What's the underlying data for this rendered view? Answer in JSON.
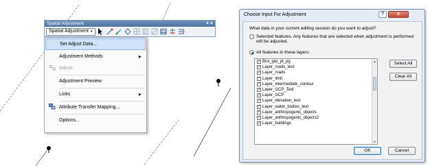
{
  "toolbar": {
    "title": "Spatial Adjustment",
    "close_glyph": "× ×",
    "dropdown_label": "Spatial Adjustment",
    "dropdown_caret": "▾",
    "tools": [
      "select-pointer-icon",
      "new-displacement-link-icon",
      "modify-link-icon",
      "multi-displacement-link-icon",
      "identity-link-icon",
      "area-of-effect-icon",
      "multi-link-icon",
      "view-link-table-icon",
      "edge-match-icon",
      "attribute-transfer-icon"
    ]
  },
  "menu": {
    "items": [
      {
        "label": "Set Adjust Data...",
        "state": "selected"
      },
      {
        "label": "Adjustment Methods",
        "submenu": true
      },
      {
        "label": "Adjust",
        "state": "disabled"
      },
      {
        "label": "Adjustment Preview"
      },
      {
        "label": "Links",
        "submenu": true
      },
      {
        "label": "Attribute Transfer Mapping..."
      },
      {
        "label": "Options..."
      }
    ],
    "submenu_arrow": "▶"
  },
  "dialog": {
    "title": "Choose Input For Adjustment",
    "help_label": "?",
    "close_label": "x",
    "question": "What data in your current editing session do you want to adjust?",
    "option_selected_features": "Selected features. Any features that are selected when adjustment is performed will be adjusted.",
    "option_all_features": "All features in these layers:",
    "layers": [
      "Bnx_grp_pt_pg",
      "Layer_roads_text",
      "Layer_roads",
      "Layer_limit",
      "Layer_intermediate_contour",
      "Layer_GCP_Text",
      "Layer_GCP",
      "Layer_elevation_text",
      "Layer_water_bodies_text",
      "Layer_anthropogenic_objects",
      "Layer_anthropogenic_objects2",
      "Layer_buildings"
    ],
    "select_all_label": "Select All",
    "clear_all_label": "Clear All",
    "ok_label": "OK",
    "cancel_label": "Cancel"
  }
}
